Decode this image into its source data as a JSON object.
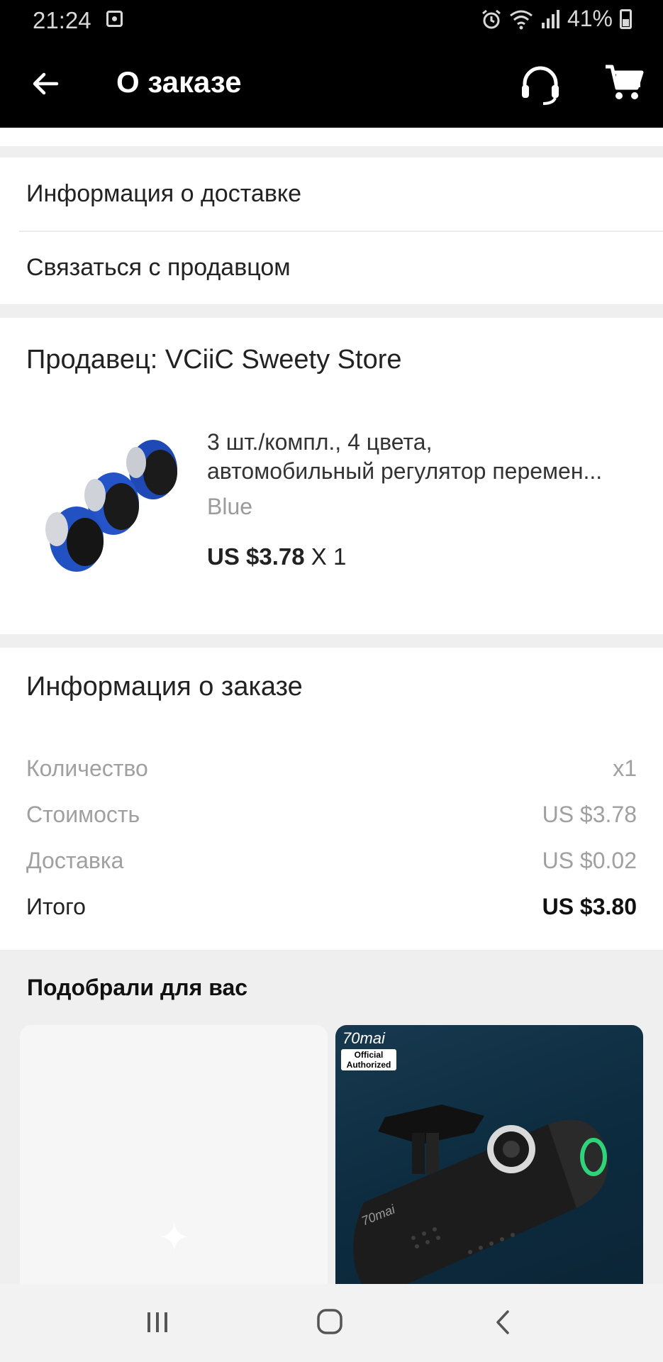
{
  "status_bar": {
    "time": "21:24",
    "battery": "41%"
  },
  "app_bar": {
    "title": "О заказе"
  },
  "links": [
    {
      "label": "Информация о доставке"
    },
    {
      "label": "Связаться с продавцом"
    }
  ],
  "seller": {
    "name": "Продавец: VCiiC Sweety Store",
    "product": {
      "title_line1": "3 шт./компл., 4 цвета,",
      "title_line2": "автомобильный регулятор перемен...",
      "variant": "Blue",
      "price": "US $3.78",
      "quantity": "X 1"
    }
  },
  "order_info": {
    "title": "Информация о заказе",
    "rows": [
      {
        "label": "Количество",
        "value": "x1"
      },
      {
        "label": "Стоимость",
        "value": "US $3.78"
      },
      {
        "label": "Доставка",
        "value": "US $0.02"
      },
      {
        "label": "Итого",
        "value": "US $3.80"
      }
    ]
  },
  "recommendations": {
    "title": "Подобрали для вас",
    "right_card": {
      "brand": "70mai",
      "badge_line1": "Official",
      "badge_line2": "Authorized",
      "device_text": "70mai"
    }
  },
  "icons": {
    "back": "arrow-left-icon",
    "support": "headset-icon",
    "cart": "cart-icon",
    "nav_recent": "recent-apps-icon",
    "nav_home": "home-icon",
    "nav_back": "chevron-left-icon"
  }
}
